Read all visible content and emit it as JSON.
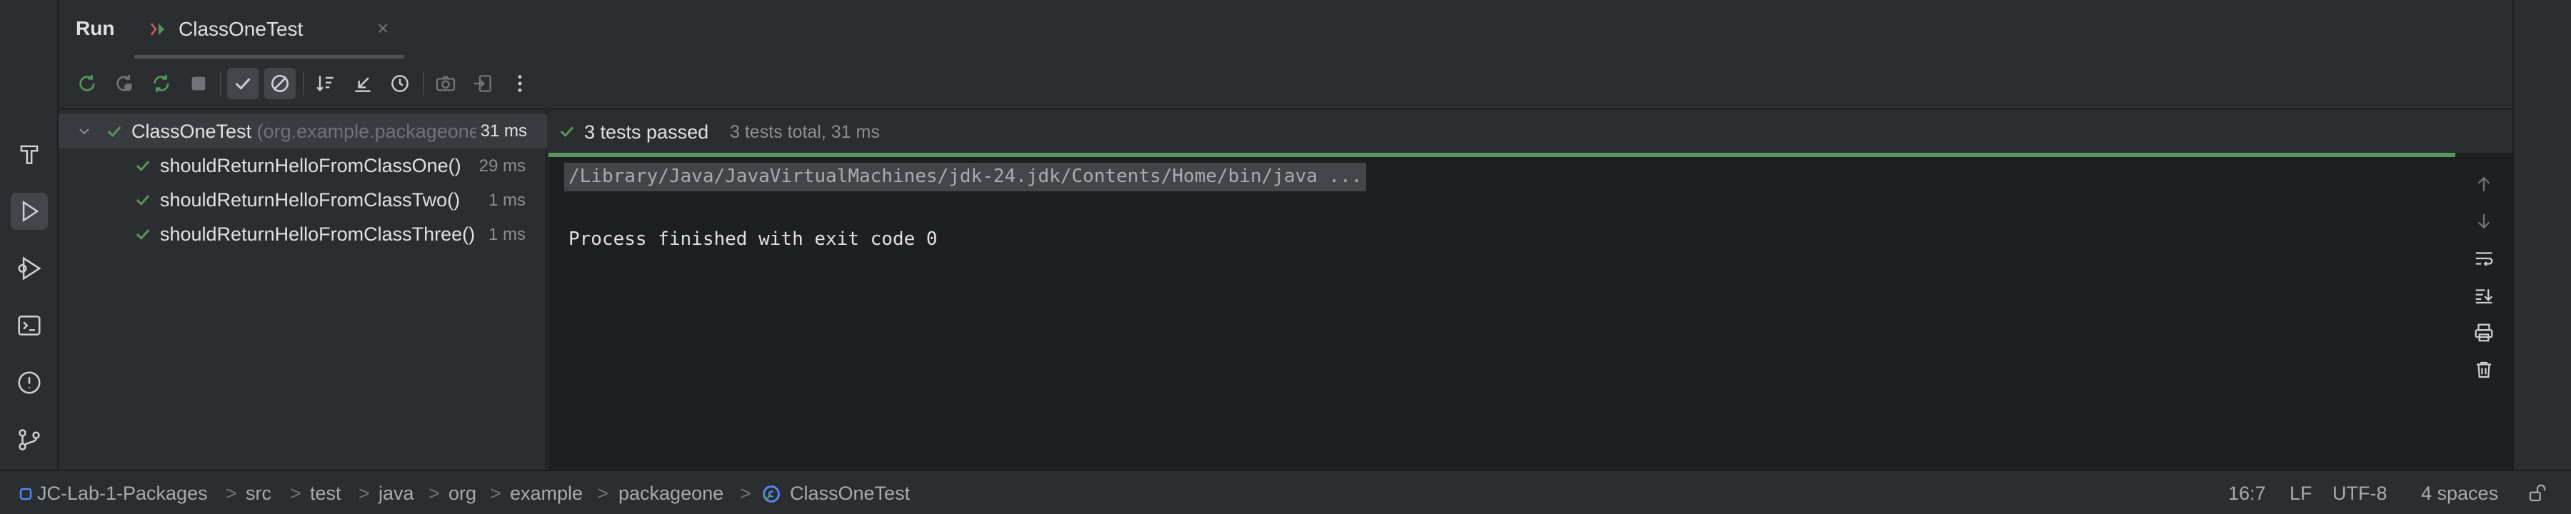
{
  "tool_window": {
    "title": "Run",
    "tab": {
      "label": "ClassOneTest",
      "close_glyph": "×",
      "icon": "test-run-icon"
    }
  },
  "left_strip": {
    "items": [
      {
        "name": "build-icon"
      },
      {
        "name": "run-icon",
        "active": true
      },
      {
        "name": "services-icon"
      },
      {
        "name": "terminal-icon"
      },
      {
        "name": "problems-icon"
      },
      {
        "name": "git-icon"
      }
    ]
  },
  "toolbar": {
    "buttons": [
      "rerun-icon",
      "rerun-failed-icon",
      "toggle-auto-test-icon",
      "stop-icon",
      "show-passed-icon",
      "show-ignored-icon",
      "sort-alpha-icon",
      "collapse-all-icon",
      "test-history-icon",
      "export-icon",
      "import-icon",
      "more-icon"
    ]
  },
  "test_tree": {
    "root": {
      "label": "ClassOneTest",
      "package": "(org.example.packageone)",
      "time": "31 ms"
    },
    "children": [
      {
        "label": "shouldReturnHelloFromClassOne()",
        "time": "29 ms"
      },
      {
        "label": "shouldReturnHelloFromClassTwo()",
        "time": "1 ms"
      },
      {
        "label": "shouldReturnHelloFromClassThree()",
        "time": "1 ms"
      }
    ]
  },
  "console": {
    "summary": "3 tests passed",
    "summary_detail": "3 tests total, 31 ms",
    "command": "/Library/Java/JavaVirtualMachines/jdk-24.jdk/Contents/Home/bin/java ...",
    "exit": "Process finished with exit code 0",
    "side_buttons": [
      "scroll-up-icon",
      "scroll-down-icon",
      "soft-wrap-icon",
      "scroll-to-end-icon",
      "print-icon",
      "clear-all-icon"
    ]
  },
  "statusbar": {
    "breadcrumbs": [
      "JC-Lab-1-Packages",
      "src",
      "test",
      "java",
      "org",
      "example",
      "packageone",
      "ClassOneTest"
    ],
    "separator": ">",
    "position": "16:7",
    "line_ending": "LF",
    "encoding": "UTF-8",
    "indent": "4 spaces",
    "lock_icon": "lock-icon"
  },
  "colors": {
    "accent": "#57965c",
    "panel": "#2b2d30",
    "editor": "#1e1f22",
    "text": "#dfe1e5"
  }
}
